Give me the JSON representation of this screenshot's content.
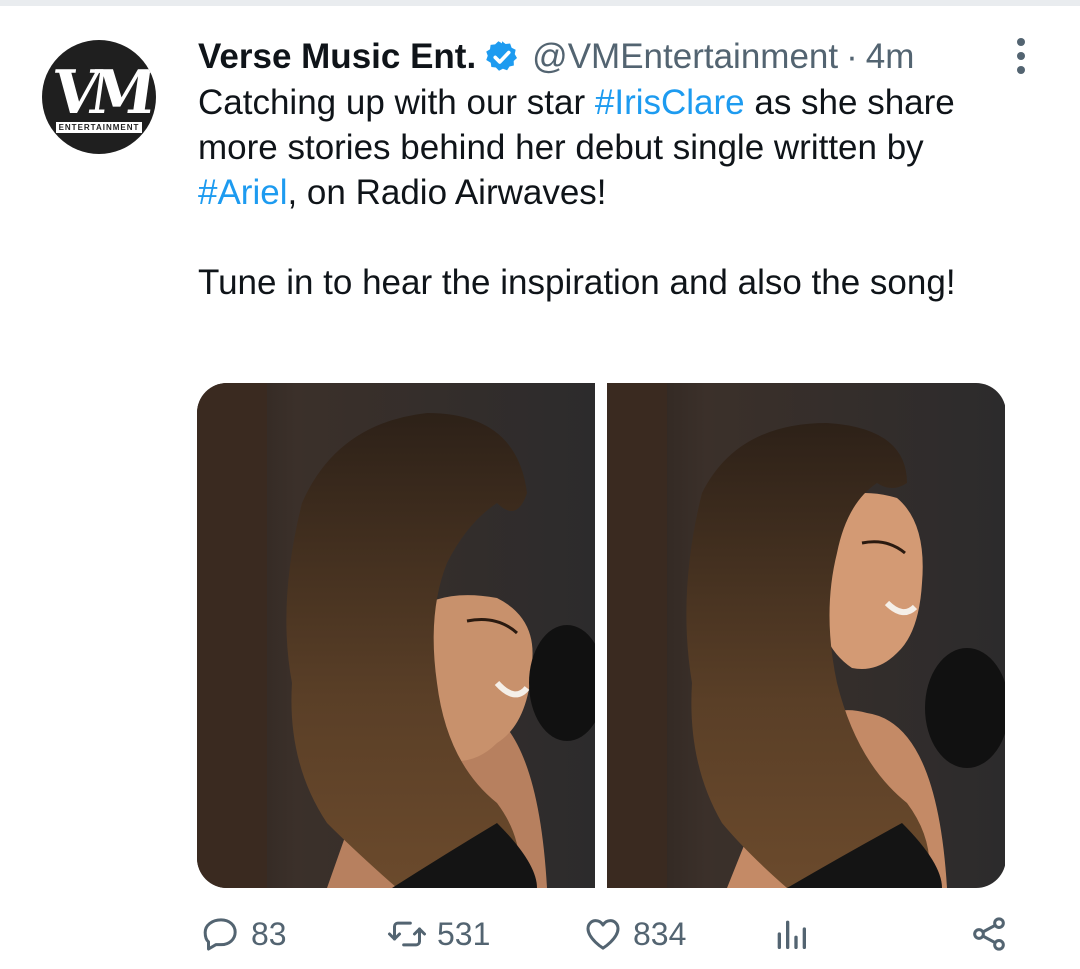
{
  "account": {
    "name": "Verse Music Ent.",
    "handle": "@VMEntertainment",
    "separator": "·",
    "time": "4m",
    "avatar_monogram": "VM",
    "avatar_subtitle": "ENTERTAINMENT",
    "verified": true
  },
  "tweet": {
    "line1_pre": "Catching up with our star ",
    "hashtag1": "#IrisClare",
    "line1_post": " as she share more stories behind her debut single written by ",
    "hashtag2": "#Ariel",
    "line1_end": ", on Radio Airwaves!",
    "paragraph2": "Tune in to hear the inspiration and also the song!"
  },
  "media": {
    "count": 2,
    "left_photo": "studio-portrait",
    "right_photo": "studio-portrait"
  },
  "actions": {
    "replies": "83",
    "retweets": "531",
    "likes": "834"
  },
  "colors": {
    "link": "#1d9bf0",
    "secondary_text": "#536471",
    "verified_badge": "#1d9bf0"
  },
  "icons": {
    "reply": "reply-icon",
    "retweet": "retweet-icon",
    "like": "heart-icon",
    "analytics": "analytics-icon",
    "share": "share-icon",
    "more": "more-vertical-icon"
  }
}
